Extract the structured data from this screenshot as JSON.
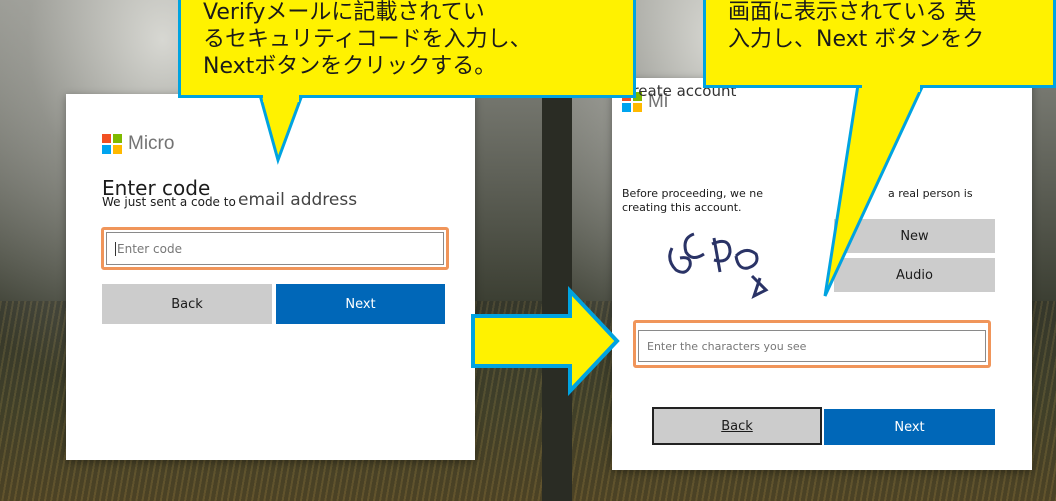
{
  "left_panel": {
    "brand": "Micro",
    "heading": "Enter code",
    "sent_text": "We just sent a code to",
    "email_text": "email address",
    "code_input": {
      "placeholder": "Enter code"
    },
    "back_label": "Back",
    "next_label": "Next",
    "callout_lines": [
      "Verifyメールに記載されてい",
      "るセキュリティコードを入力し、",
      "Nextボタンをクリックする。"
    ]
  },
  "right_panel": {
    "brand": "Mi",
    "heading": "Create account",
    "desc_line1_left": "Before proceeding, we ne",
    "desc_line1_right": "a real person is",
    "desc_line2": "creating this account.",
    "new_label": "New",
    "audio_label": "Audio",
    "chars_input": {
      "placeholder": "Enter the characters you see"
    },
    "back_label": "Back",
    "next_label": "Next",
    "callout_lines": [
      "画面に表示されている 英",
      "入力し、Next ボタンをク"
    ]
  },
  "colors": {
    "callout_fill": "#fff200",
    "callout_border": "#00a3e0",
    "highlight": "#f0955a",
    "primary_button": "#0067b8"
  }
}
